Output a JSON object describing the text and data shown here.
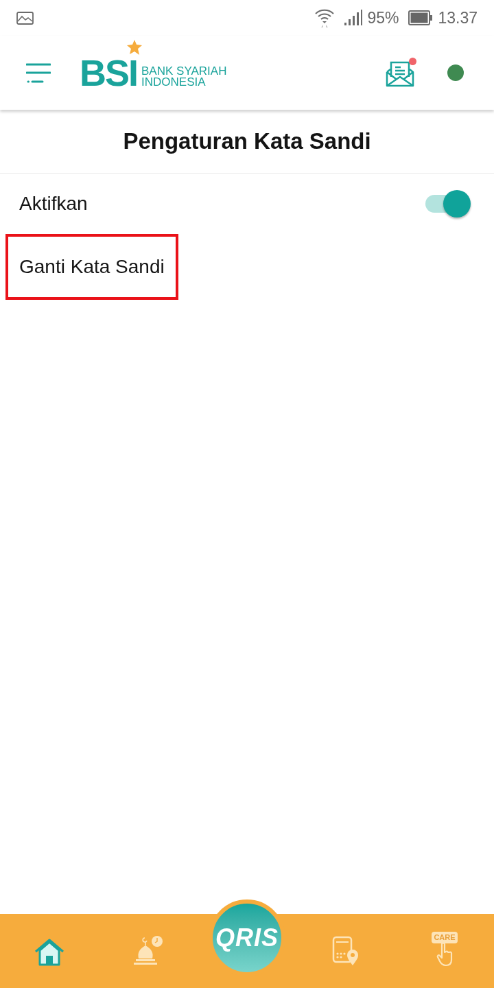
{
  "status_bar": {
    "battery_percent": "95%",
    "time": "13.37"
  },
  "header": {
    "logo": {
      "mark": "BSI",
      "name_lines": [
        "BANK SYARIAH",
        "INDONESIA"
      ]
    },
    "inbox_unread": true
  },
  "page_title": "Pengaturan Kata Sandi",
  "settings": [
    {
      "kind": "toggle",
      "label": "Aktifkan",
      "on": true,
      "highlighted": false
    },
    {
      "kind": "link",
      "label": "Ganti Kata Sandi",
      "highlighted": true
    }
  ],
  "bottom_nav": [
    {
      "kind": "home",
      "selected": true
    },
    {
      "kind": "prayer",
      "selected": false
    },
    {
      "kind": "qris",
      "label": "QRIS",
      "selected": false
    },
    {
      "kind": "atm_locator",
      "selected": false
    },
    {
      "kind": "care",
      "label": "CARE",
      "selected": false
    }
  ]
}
